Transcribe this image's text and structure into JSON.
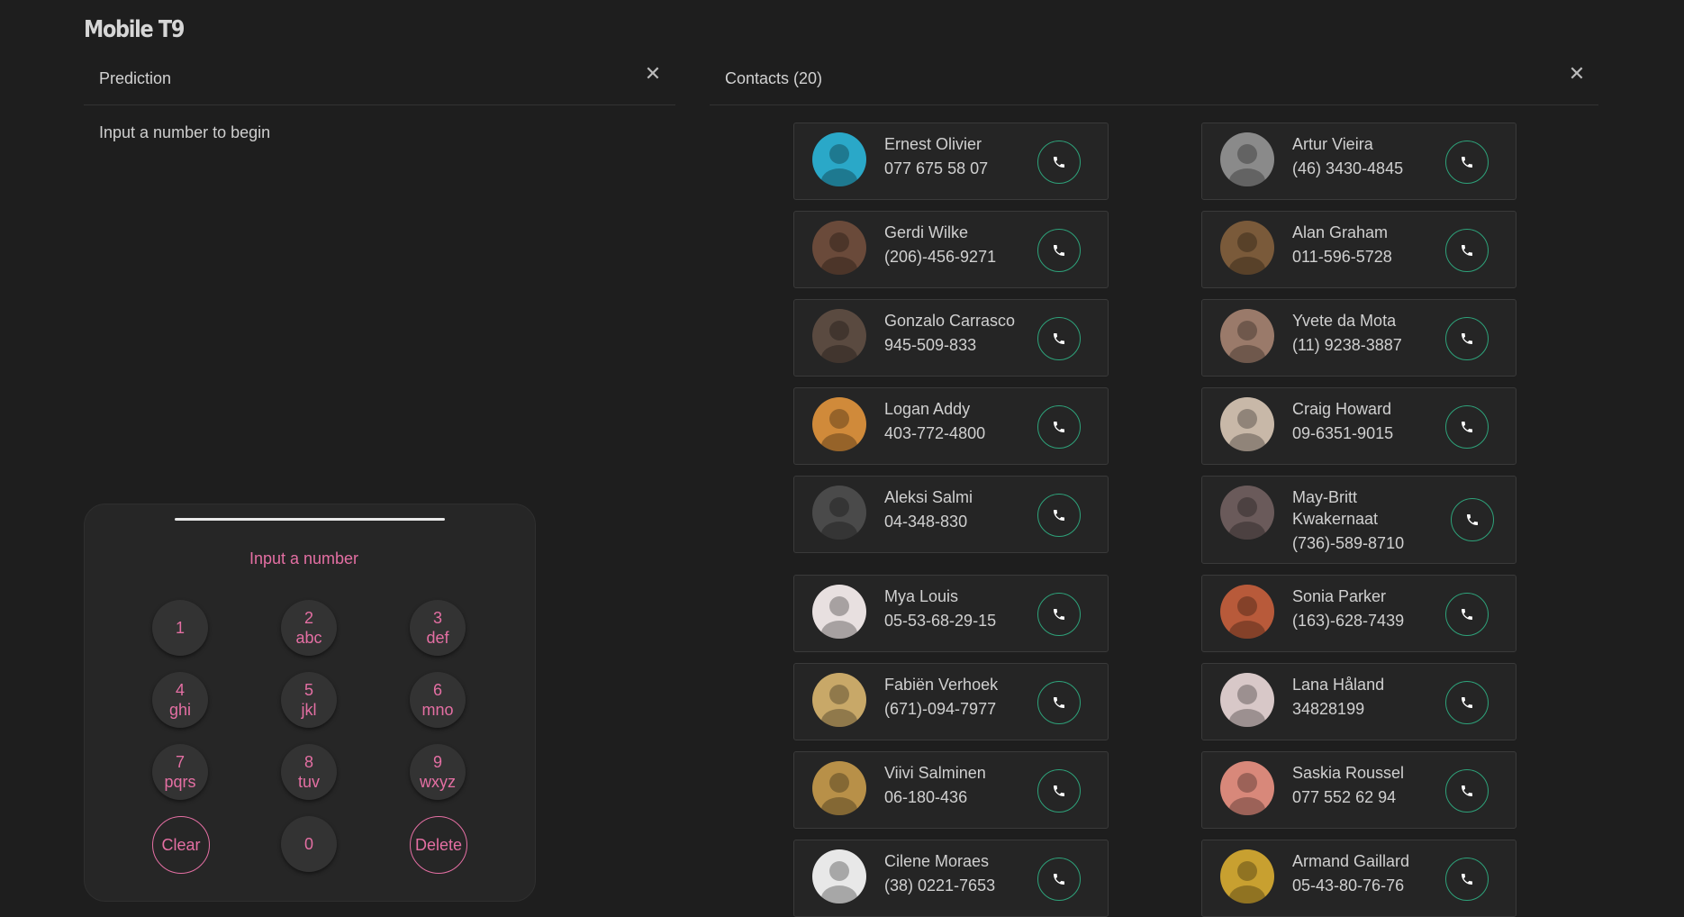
{
  "app": {
    "title": "Mobile T9"
  },
  "prediction": {
    "title": "Prediction",
    "close_icon": "close-icon",
    "message": "Input a number to begin"
  },
  "keypad": {
    "input_placeholder": "Input a number",
    "keys": [
      {
        "digit": "1",
        "letters": ""
      },
      {
        "digit": "2",
        "letters": "abc"
      },
      {
        "digit": "3",
        "letters": "def"
      },
      {
        "digit": "4",
        "letters": "ghi"
      },
      {
        "digit": "5",
        "letters": "jkl"
      },
      {
        "digit": "6",
        "letters": "mno"
      },
      {
        "digit": "7",
        "letters": "pqrs"
      },
      {
        "digit": "8",
        "letters": "tuv"
      },
      {
        "digit": "9",
        "letters": "wxyz"
      },
      {
        "digit": "Clear",
        "letters": ""
      },
      {
        "digit": "0",
        "letters": ""
      },
      {
        "digit": "Delete",
        "letters": ""
      }
    ],
    "accent_color": "#e46fa3"
  },
  "contacts": {
    "title": "Contacts (20)",
    "close_icon": "close-icon",
    "call_icon": "phone-icon",
    "call_color": "#2ea27a",
    "left": [
      {
        "name": "Ernest Olivier",
        "phone": "077 675 58 07",
        "avatar_color": "#2aa8c8"
      },
      {
        "name": "Gerdi Wilke",
        "phone": "(206)-456-9271",
        "avatar_color": "#6a4a3a"
      },
      {
        "name": "Gonzalo Carrasco",
        "phone": "945-509-833",
        "avatar_color": "#5a4a40"
      },
      {
        "name": "Logan Addy",
        "phone": "403-772-4800",
        "avatar_color": "#d08a3a"
      },
      {
        "name": "Aleksi Salmi",
        "phone": "04-348-830",
        "avatar_color": "#4a4a4a"
      },
      {
        "name": "Mya Louis",
        "phone": "05-53-68-29-15",
        "avatar_color": "#e8e0e0"
      },
      {
        "name": "Fabiën Verhoek",
        "phone": "(671)-094-7977",
        "avatar_color": "#c8a868"
      },
      {
        "name": "Viivi Salminen",
        "phone": "06-180-436",
        "avatar_color": "#b89048"
      },
      {
        "name": "Cilene Moraes",
        "phone": "(38) 0221-7653",
        "avatar_color": "#e8e8e8"
      }
    ],
    "right": [
      {
        "name": "Artur Vieira",
        "phone": "(46) 3430-4845",
        "avatar_color": "#8a8a8a"
      },
      {
        "name": "Alan Graham",
        "phone": "011-596-5728",
        "avatar_color": "#7a5a3a"
      },
      {
        "name": "Yvete da Mota",
        "phone": "(11) 9238-3887",
        "avatar_color": "#9a7a6a"
      },
      {
        "name": "Craig Howard",
        "phone": "09-6351-9015",
        "avatar_color": "#c8b8a8"
      },
      {
        "name": "May-Britt Kwakernaat",
        "phone": "(736)-589-8710",
        "avatar_color": "#6a5a5a"
      },
      {
        "name": "Sonia Parker",
        "phone": "(163)-628-7439",
        "avatar_color": "#b85a3a"
      },
      {
        "name": "Lana Håland",
        "phone": "34828199",
        "avatar_color": "#d8c8c8"
      },
      {
        "name": "Saskia Roussel",
        "phone": "077 552 62 94",
        "avatar_color": "#d8887a"
      },
      {
        "name": "Armand Gaillard",
        "phone": "05-43-80-76-76",
        "avatar_color": "#c8a030"
      }
    ]
  }
}
